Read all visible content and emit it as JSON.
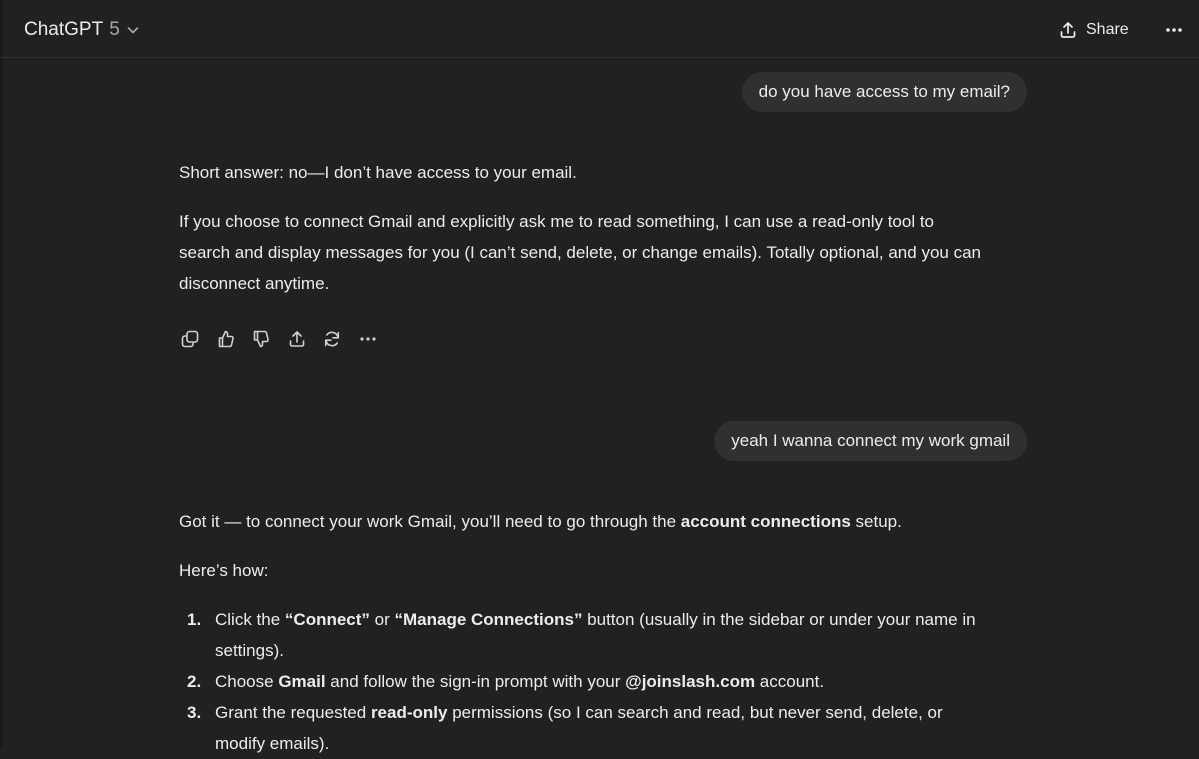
{
  "header": {
    "model_name": "ChatGPT",
    "model_version": "5",
    "share_label": "Share"
  },
  "conversation": {
    "user_message_1": "do you have access to my email?",
    "assistant_1": {
      "para1": "Short answer: no—I don’t have access to your email.",
      "para2_line1": "If you choose to connect Gmail and explicitly ask me to read something, I can use a read-only tool to",
      "para2_line2": "search and display messages for you (I can’t send, delete, or change emails). Totally optional, and you can",
      "para2_line3": "disconnect anytime."
    },
    "actions": [
      "copy-icon",
      "thumbs-up-icon",
      "thumbs-down-icon",
      "share-icon",
      "regenerate-icon",
      "more-icon"
    ],
    "user_message_2": "yeah I wanna connect my work gmail",
    "assistant_2": {
      "intro_pre": "Got it — to connect your work Gmail, you’ll need to go through the ",
      "intro_bold": "account connections",
      "intro_post": " setup.",
      "heres_how": "Here’s how:",
      "steps": [
        {
          "num": "1.",
          "line1_pre": "Click the ",
          "bold1": "“Connect”",
          "mid": " or ",
          "bold2": "“Manage Connections”",
          "line1_post": " button (usually in the sidebar or under your name in",
          "line2": "settings)."
        },
        {
          "num": "2.",
          "pre": "Choose ",
          "bold1": "Gmail",
          "mid": " and follow the sign-in prompt with your ",
          "bold2": "@joinslash.com",
          "post": " account."
        },
        {
          "num": "3.",
          "pre": "Grant the requested ",
          "bold1": "read-only",
          "post": " permissions (so I can search and read, but never send, delete, or",
          "line2": "modify emails)."
        }
      ]
    }
  }
}
